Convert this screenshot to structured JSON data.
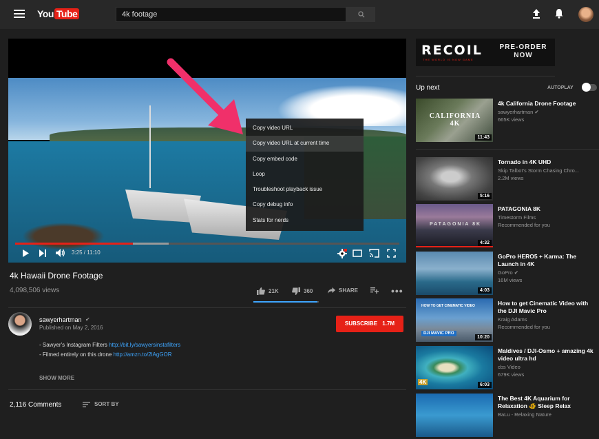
{
  "header": {
    "logo_you": "You",
    "logo_tube": "Tube",
    "search_value": "4k footage"
  },
  "player": {
    "time": "3:25 / 11:10",
    "progress_played": 0.306,
    "progress_buffered": 0.4,
    "context_menu": [
      "Copy video URL",
      "Copy video URL at current time",
      "Copy embed code",
      "Loop",
      "Troubleshoot playback issue",
      "Copy debug info",
      "Stats for nerds"
    ]
  },
  "video": {
    "title": "4k Hawaii Drone Footage",
    "views": "4,098,506 views",
    "likes": "21K",
    "dislikes": "360",
    "share_label": "SHARE",
    "like_ratio": 0.98
  },
  "channel": {
    "name": "sawyerhartman",
    "published": "Published on May 2, 2016",
    "subscribe_label": "SUBSCRIBE",
    "subscribers": "1.7M"
  },
  "description": {
    "line1_text": "- Sawyer's Instagram Filters ",
    "line1_link": "http://bit.ly/sawyersinstafilters",
    "line2_text": "- Filmed entirely on this drone ",
    "line2_link": "http://amzn.to/2lAgGOR",
    "show_more": "SHOW MORE"
  },
  "comments": {
    "count": "2,116 Comments",
    "sort_label": "SORT BY"
  },
  "ad": {
    "title": "RECOIL",
    "tagline": "THE WORLD IS NOW GAME",
    "cta_line1": "PRE-ORDER",
    "cta_line2": "NOW"
  },
  "sidebar": {
    "up_next": "Up next",
    "autoplay": "AUTOPLAY",
    "recommendations": [
      {
        "title": "4k California Drone Footage",
        "channel": "sawyerhartman",
        "meta": "665K views",
        "duration": "11:43",
        "thumb_text": "CALIFORNIA 4K"
      },
      {
        "title": "Tornado in 4K UHD",
        "channel": "Skip Talbot's Storm Chasing Chro...",
        "meta": "2.2M views",
        "duration": "5:16",
        "thumb_text": ""
      },
      {
        "title": "PATAGONIA 8K",
        "channel": "Timestorm Films",
        "meta": "Recommended for you",
        "duration": "4:32",
        "thumb_text": "PATAGONIA 8K"
      },
      {
        "title": "GoPro HERO5 + Karma: The Launch in 4K",
        "channel": "GoPro",
        "meta": "16M views",
        "duration": "4:03",
        "thumb_text": ""
      },
      {
        "title": "How to get Cinematic Video with the DJI Mavic Pro",
        "channel": "Kraig Adams",
        "meta": "Recommended for you",
        "duration": "10:20",
        "thumb_text": "HOW TO GET CINEMATIC VIDEO",
        "thumb_text2": "DJI MAVIC PRO"
      },
      {
        "title": "Maldives / DJI-Osmo + amazing 4k video ultra hd",
        "channel": "cbs Video",
        "meta": "679K views",
        "duration": "6:03",
        "thumb_text": "4K"
      },
      {
        "title": "The Best 4K Aquarium for Relaxation 🐠 Sleep Relax",
        "channel": "BaLu - Relaxing Nature",
        "meta": "",
        "duration": "",
        "thumb_text": ""
      }
    ]
  },
  "colors": {
    "brand_red": "#e62117",
    "link_blue": "#3ea6ff",
    "arrow_pink": "#f0306a",
    "background": "#1f1f1f"
  }
}
